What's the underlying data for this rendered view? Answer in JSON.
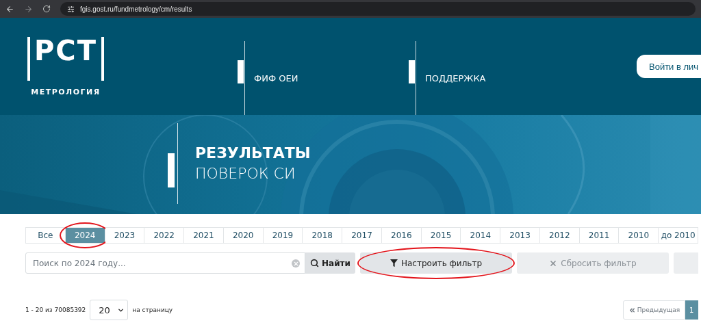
{
  "browser": {
    "url": "fgis.gost.ru/fundmetrology/cm/results"
  },
  "header": {
    "logo": {
      "mark": "РСТ",
      "caption": "МЕТРОЛОГИЯ"
    },
    "nav": [
      "ФИФ ОЕИ",
      "ПОДДЕРЖКА"
    ],
    "login": "Войти в лич"
  },
  "banner": {
    "title": "РЕЗУЛЬТАТЫ",
    "subtitle": "ПОВЕРОК СИ"
  },
  "years": [
    {
      "label": "Все",
      "selected": false,
      "circled": false
    },
    {
      "label": "2024",
      "selected": true,
      "circled": true
    },
    {
      "label": "2023",
      "selected": false,
      "circled": false
    },
    {
      "label": "2022",
      "selected": false,
      "circled": false
    },
    {
      "label": "2021",
      "selected": false,
      "circled": false
    },
    {
      "label": "2020",
      "selected": false,
      "circled": false
    },
    {
      "label": "2019",
      "selected": false,
      "circled": false
    },
    {
      "label": "2018",
      "selected": false,
      "circled": false
    },
    {
      "label": "2017",
      "selected": false,
      "circled": false
    },
    {
      "label": "2016",
      "selected": false,
      "circled": false
    },
    {
      "label": "2015",
      "selected": false,
      "circled": false
    },
    {
      "label": "2014",
      "selected": false,
      "circled": false
    },
    {
      "label": "2013",
      "selected": false,
      "circled": false
    },
    {
      "label": "2012",
      "selected": false,
      "circled": false
    },
    {
      "label": "2011",
      "selected": false,
      "circled": false
    },
    {
      "label": "2010",
      "selected": false,
      "circled": false
    },
    {
      "label": "до 2010",
      "selected": false,
      "circled": false
    }
  ],
  "search": {
    "placeholder": "Поиск по 2024 году...",
    "find": "Найти",
    "filter": {
      "label": "Настроить фильтр",
      "circled": true
    },
    "reset": {
      "label": "Сбросить фильтр",
      "disabled": true
    }
  },
  "pagination": {
    "range": "1 - 20 из 70085392",
    "per_page": "20",
    "per_page_label": "на страницу",
    "prev": "Предыдущая",
    "pages": [
      {
        "label": "1",
        "selected": true
      }
    ]
  }
}
